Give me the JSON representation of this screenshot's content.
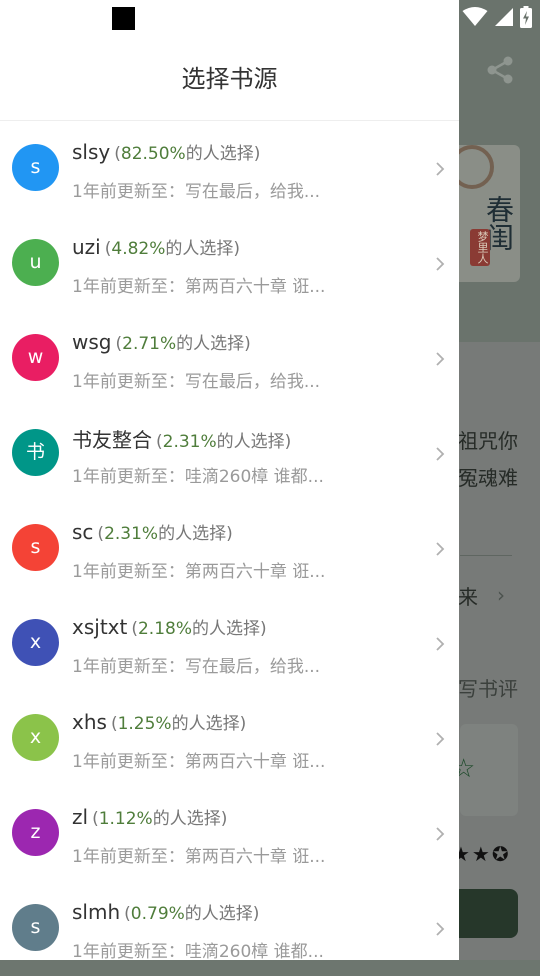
{
  "background": {
    "text_lines": [
      "祖咒你",
      "冤魂难",
      "来",
      "写书评"
    ],
    "cover_title": "春闺",
    "cover_subtitle": "梦里人"
  },
  "drawer": {
    "title": "选择书源",
    "pct_suffix": "的人选择",
    "update_prefix": "1年前更新至：",
    "sources": [
      {
        "avatar": "s",
        "color": "#2196f3",
        "name": "slsy",
        "pct": "82.50%",
        "update": "写在最后，给我..."
      },
      {
        "avatar": "u",
        "color": "#4caf50",
        "name": "uzi",
        "pct": "4.82%",
        "update": "第两百六十章 诳..."
      },
      {
        "avatar": "w",
        "color": "#e91e63",
        "name": "wsg",
        "pct": "2.71%",
        "update": "写在最后，给我..."
      },
      {
        "avatar": "书",
        "color": "#009688",
        "name": "书友整合",
        "pct": "2.31%",
        "update": "哇滴260樟 谁都..."
      },
      {
        "avatar": "s",
        "color": "#f44336",
        "name": "sc",
        "pct": "2.31%",
        "update": "第两百六十章 诳..."
      },
      {
        "avatar": "x",
        "color": "#3f51b5",
        "name": "xsjtxt",
        "pct": "2.18%",
        "update": "写在最后，给我..."
      },
      {
        "avatar": "x",
        "color": "#8bc34a",
        "name": "xhs",
        "pct": "1.25%",
        "update": "第两百六十章 诳..."
      },
      {
        "avatar": "z",
        "color": "#9c27b0",
        "name": "zl",
        "pct": "1.12%",
        "update": "第两百六十章 诳..."
      },
      {
        "avatar": "s",
        "color": "#607d8b",
        "name": "slmh",
        "pct": "0.79%",
        "update": "哇滴260樟 谁都..."
      }
    ]
  }
}
